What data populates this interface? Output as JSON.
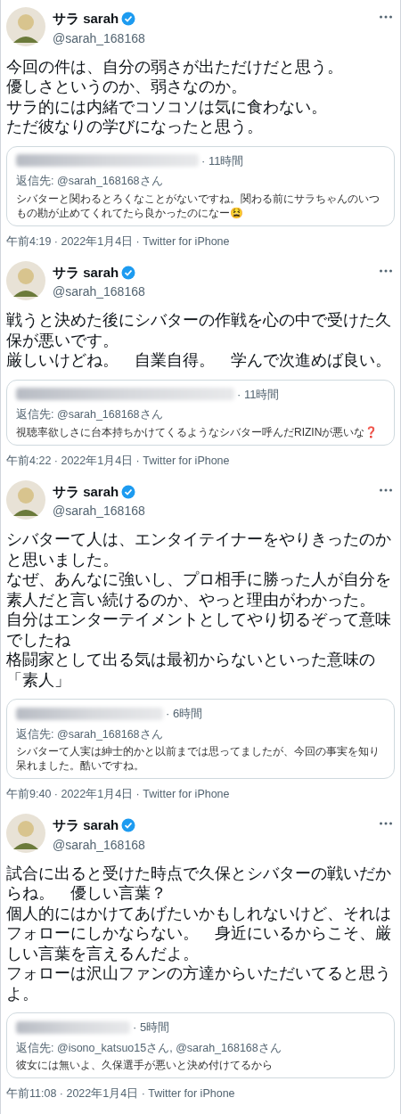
{
  "tweets": [
    {
      "name": "サラ sarah",
      "verified": true,
      "handle": "@sarah_168168",
      "body": [
        "今回の件は、自分の弱さが出ただけだと思う。",
        "優しさというのか、弱さなのか。",
        "サラ的には内緒でコソコソは気に食わない。",
        "ただ彼なりの学びになったと思う。"
      ],
      "quote": {
        "time": "· 11時間",
        "reply_to": "返信先: @sarah_168168さん",
        "text": "シバターと関わるとろくなことがないですね。関わる前にサラちゃんのいつもの勘が止めてくれてたら良かったのになー😫"
      },
      "footer": "午前4:19 · 2022年1月4日 · Twitter for iPhone"
    },
    {
      "name": "サラ sarah",
      "verified": true,
      "handle": "@sarah_168168",
      "body": [
        "戦うと決めた後にシバターの作戦を心の中で受けた久保が悪いです。",
        "厳しいけどね。　自業自得。　学んで次進めば良い。"
      ],
      "quote": {
        "time": "· 11時間",
        "reply_to": "返信先: @sarah_168168さん",
        "text": "視聴率欲しさに台本持ちかけてくるようなシバター呼んだRIZINが悪いな❓"
      },
      "footer": "午前4:22 · 2022年1月4日 · Twitter for iPhone"
    },
    {
      "name": "サラ sarah",
      "verified": true,
      "handle": "@sarah_168168",
      "body": [
        "シバターて人は、エンタイテイナーをやりきったのかと思いました。",
        "なぜ、あんなに強いし、プロ相手に勝った人が自分を素人だと言い続けるのか、やっと理由がわかった。",
        "自分はエンターテイメントとしてやり切るぞって意味でしたね",
        "格闘家として出る気は最初からないといった意味の「素人」"
      ],
      "quote": {
        "time": "· 6時間",
        "reply_to": "返信先: @sarah_168168さん",
        "text": "シバターて人実は紳士的かと以前までは思ってましたが、今回の事実を知り呆れました。酷いですね。"
      },
      "footer": "午前9:40 · 2022年1月4日 · Twitter for iPhone"
    },
    {
      "name": "サラ sarah",
      "verified": true,
      "handle": "@sarah_168168",
      "body": [
        "試合に出ると受けた時点で久保とシバターの戦いだからね。　優しい言葉？",
        "個人的にはかけてあげたいかもしれないけど、それはフォローにしかならない。　身近にいるからこそ、厳しい言葉を言えるんだよ。",
        "フォローは沢山ファンの方達からいただいてると思うよ。"
      ],
      "quote": {
        "time": "· 5時間",
        "reply_to": "返信先: @isono_katsuo15さん, @sarah_168168さん",
        "text": "彼女には無いよ、久保選手が悪いと決め付けてるから"
      },
      "footer": "午前11:08 · 2022年1月4日 · Twitter for iPhone"
    }
  ]
}
